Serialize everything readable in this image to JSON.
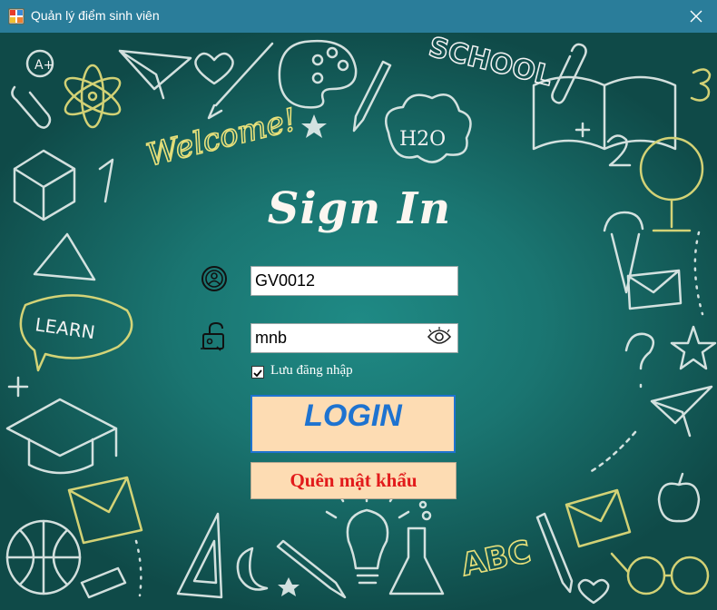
{
  "window": {
    "title": "Quản lý điểm sinh viên"
  },
  "board": {
    "welcome_text": "Welcome!",
    "school_text": "SCHOOL",
    "learn_text": "LEARN",
    "h2o_text": "H2O",
    "abc_text": "ABC"
  },
  "login": {
    "heading": "Sign In",
    "username": "GV0012",
    "password": "mnb",
    "remember_label": "Lưu đăng nhập",
    "remember_checked": true,
    "login_button": "LOGIN",
    "forgot_button": "Quên mật khẩu"
  },
  "colors": {
    "titlebar": "#2a7d9a",
    "board": "#1a7571",
    "button_bg": "#fddcb3",
    "login_text": "#1e73d0",
    "forgot_text": "#e21b1b"
  },
  "icons": [
    "app-icon",
    "close-icon",
    "user-icon",
    "lock-icon",
    "eye-icon",
    "checkmark-icon"
  ]
}
